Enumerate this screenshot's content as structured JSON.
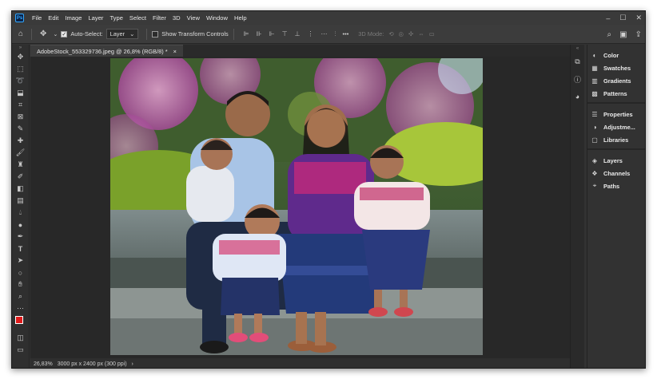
{
  "menu": [
    "File",
    "Edit",
    "Image",
    "Layer",
    "Type",
    "Select",
    "Filter",
    "3D",
    "View",
    "Window",
    "Help"
  ],
  "window_controls": [
    "–",
    "☐",
    "✕"
  ],
  "options": {
    "auto_select_label": "Auto-Select:",
    "auto_select_checked": true,
    "layer_select": "Layer",
    "show_transform_label": "Show Transform Controls",
    "more": "•••",
    "mode_3d_label": "3D Mode:"
  },
  "document": {
    "tab_title": "AdobeStock_553329736.jpeg @ 26,8% (RGB/8) *",
    "close": "×"
  },
  "status": {
    "zoom": "26,83%",
    "info": "3000 px x 2400 px (300 ppi)",
    "arrow": "›"
  },
  "panels": {
    "group1": [
      "Color",
      "Swatches",
      "Gradients",
      "Patterns"
    ],
    "group2": [
      "Properties",
      "Adjustme...",
      "Libraries"
    ],
    "group3": [
      "Layers",
      "Channels",
      "Paths"
    ]
  },
  "colors": {
    "foreground": "#e01b1b",
    "background": "#ffffff",
    "accent": "#31a8ff"
  },
  "tools": [
    "move-tool",
    "marquee-tool",
    "lasso-tool",
    "object-select-tool",
    "crop-tool",
    "frame-tool",
    "eyedropper-tool",
    "healing-tool",
    "brush-tool",
    "stamp-tool",
    "history-brush-tool",
    "eraser-tool",
    "gradient-tool",
    "blur-tool",
    "dodge-tool",
    "pen-tool",
    "type-tool",
    "path-select-tool",
    "shape-tool",
    "hand-tool",
    "zoom-tool",
    "edit-toolbar"
  ]
}
